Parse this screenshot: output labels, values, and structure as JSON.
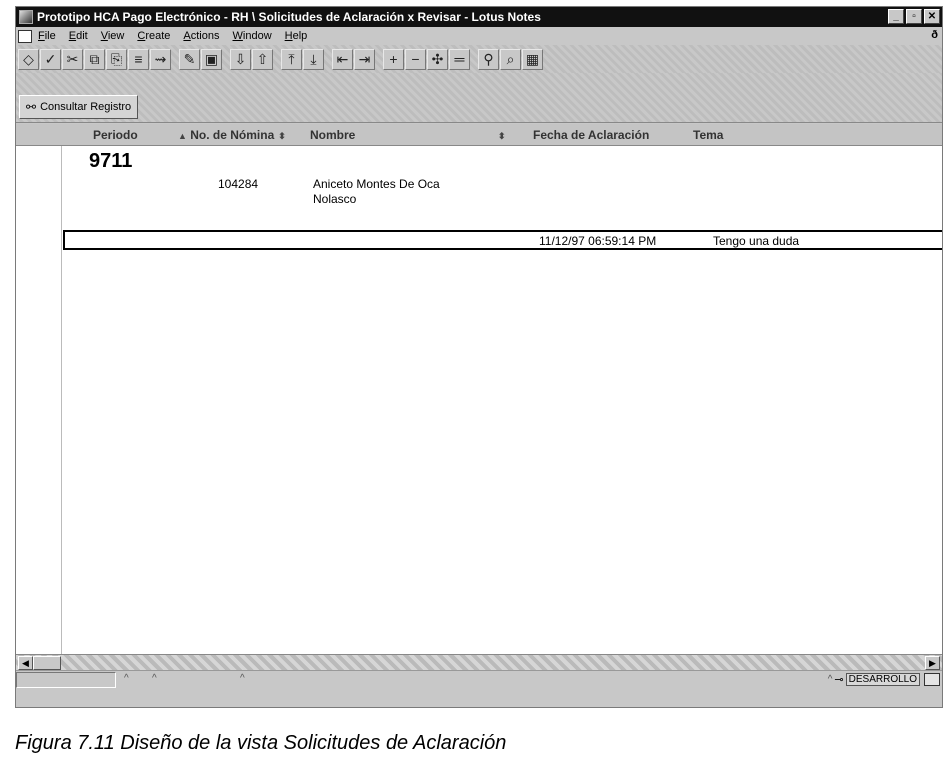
{
  "window": {
    "title": "Prototipo HCA Pago Electrónico - RH \\ Solicitudes de Aclaración x Revisar - Lotus Notes",
    "min_label": "_",
    "max_label": "▫",
    "close_label": "✕",
    "doc_close": "ð"
  },
  "menu": [
    "File",
    "Edit",
    "View",
    "Create",
    "Actions",
    "Window",
    "Help"
  ],
  "toolbar": {
    "icons": [
      {
        "name": "navigate-icon",
        "glyph": "◇"
      },
      {
        "name": "smarticon-check-icon",
        "glyph": "✓"
      },
      {
        "name": "cut-icon",
        "glyph": "✂"
      },
      {
        "name": "copy-icon",
        "glyph": "⧉"
      },
      {
        "name": "paste-icon",
        "glyph": "⎘"
      },
      {
        "name": "categorize-icon",
        "glyph": "≡"
      },
      {
        "name": "link-icon",
        "glyph": "⇝"
      },
      {
        "name": "edit-document-icon",
        "glyph": "✎"
      },
      {
        "name": "open-document-icon",
        "glyph": "▣"
      },
      {
        "name": "collapse-icon",
        "glyph": "⇩"
      },
      {
        "name": "expand-icon",
        "glyph": "⇧"
      },
      {
        "name": "previous-unread-icon",
        "glyph": "⤒"
      },
      {
        "name": "next-unread-icon",
        "glyph": "⤓"
      },
      {
        "name": "previous-main-icon",
        "glyph": "⇤"
      },
      {
        "name": "next-main-icon",
        "glyph": "⇥"
      },
      {
        "name": "expand-all-icon",
        "glyph": "+"
      },
      {
        "name": "collapse-all-icon",
        "glyph": "−"
      },
      {
        "name": "expand-selected-icon",
        "glyph": "✣"
      },
      {
        "name": "collapse-selected-icon",
        "glyph": "═"
      },
      {
        "name": "search-icon",
        "glyph": "⚲"
      },
      {
        "name": "find-icon",
        "glyph": "⌕"
      },
      {
        "name": "refresh-icon",
        "glyph": "▦"
      }
    ]
  },
  "actions": {
    "consultar_label": "Consultar Registro"
  },
  "view": {
    "columns": {
      "periodo": "Periodo",
      "nomina": "No. de Nómina",
      "nombre": "Nombre",
      "fecha": "Fecha de Aclaración",
      "tema": "Tema"
    },
    "category": "9711",
    "employee": {
      "nomina": "104284",
      "nombre_line1": "Aniceto Montes De Oca",
      "nombre_line2": "Nolasco"
    },
    "document": {
      "fecha": "11/12/97 06:59:14 PM",
      "tema": "Tengo una duda"
    }
  },
  "status": {
    "server": "DESARROLLO"
  },
  "caption": "Figura 7.11 Diseño de la vista Solicitudes  de Aclaración"
}
